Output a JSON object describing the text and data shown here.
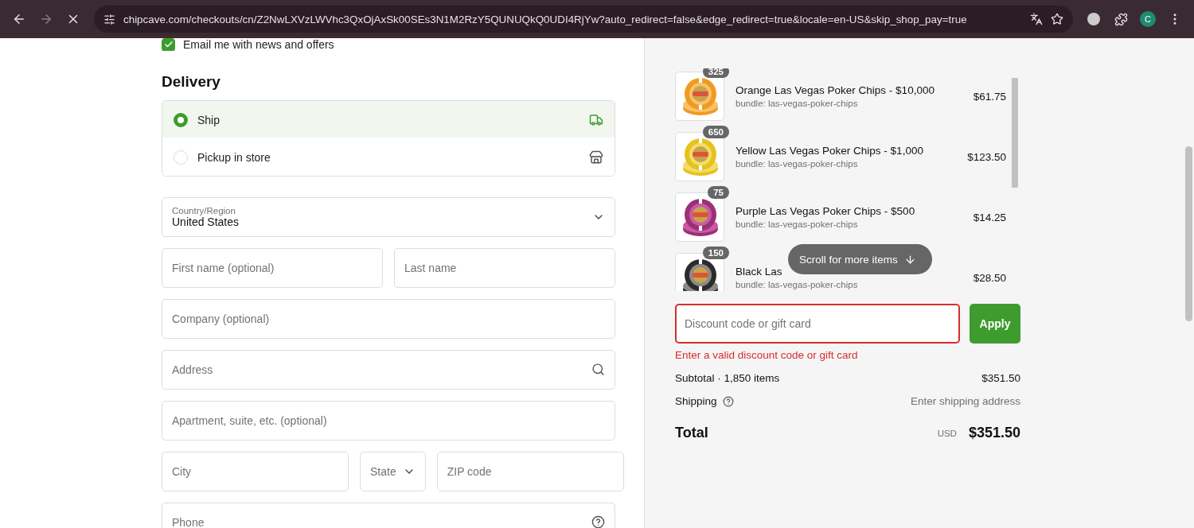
{
  "browser": {
    "url": "chipcave.com/checkouts/cn/Z2NwLXVzLWVhc3QxOjAxSk00SEs3N1M2RzY5QUNUQkQ0UDI4RjYw?auto_redirect=false&edge_redirect=true&locale=en-US&skip_shop_pay=true",
    "profile_initial": "C"
  },
  "email_checkbox": {
    "label": "Email me with news and offers",
    "checked": true
  },
  "delivery": {
    "title": "Delivery",
    "options": [
      {
        "label": "Ship",
        "selected": true,
        "kind": "ship"
      },
      {
        "label": "Pickup in store",
        "selected": false,
        "kind": "store"
      }
    ]
  },
  "form_rows": [
    [
      {
        "kind": "select",
        "label": "Country/Region",
        "value": "United States"
      }
    ],
    [
      {
        "kind": "input",
        "placeholder": "First name (optional)"
      },
      {
        "kind": "input",
        "placeholder": "Last name"
      }
    ],
    [
      {
        "kind": "input",
        "placeholder": "Company (optional)"
      }
    ],
    [
      {
        "kind": "search",
        "placeholder": "Address"
      }
    ],
    [
      {
        "kind": "input",
        "placeholder": "Apartment, suite, etc. (optional)"
      }
    ],
    [
      {
        "kind": "input",
        "placeholder": "City"
      },
      {
        "kind": "select",
        "placeholder": "State"
      },
      {
        "kind": "input",
        "placeholder": "ZIP code"
      }
    ],
    [
      {
        "kind": "help",
        "placeholder": "Phone"
      }
    ]
  ],
  "order": {
    "items": [
      {
        "quantity": "325",
        "title": "Orange Las Vegas Poker Chips - $10,000",
        "bundle": "bundle: las-vegas-poker-chips",
        "price": "$61.75"
      },
      {
        "quantity": "650",
        "title": "Yellow Las Vegas Poker Chips - $1,000",
        "bundle": "bundle: las-vegas-poker-chips",
        "price": "$123.50"
      },
      {
        "quantity": "75",
        "title": "Purple Las Vegas Poker Chips - $500",
        "bundle": "bundle: las-vegas-poker-chips",
        "price": "$14.25"
      },
      {
        "quantity": "150",
        "title": "Black Las",
        "bundle": "bundle: las-vegas-poker-chips",
        "price": "$28.50"
      }
    ],
    "scroll_hint": "Scroll for more items",
    "discount": {
      "placeholder": "Discount code or gift card",
      "error": "Enter a valid discount code or gift card",
      "button": "Apply"
    },
    "subtotal": {
      "label": "Subtotal · 1,850 items",
      "value": "$351.50"
    },
    "shipping": {
      "label": "Shipping",
      "value": "Enter shipping address"
    },
    "total": {
      "label": "Total",
      "currency": "USD",
      "value": "$351.50"
    }
  }
}
